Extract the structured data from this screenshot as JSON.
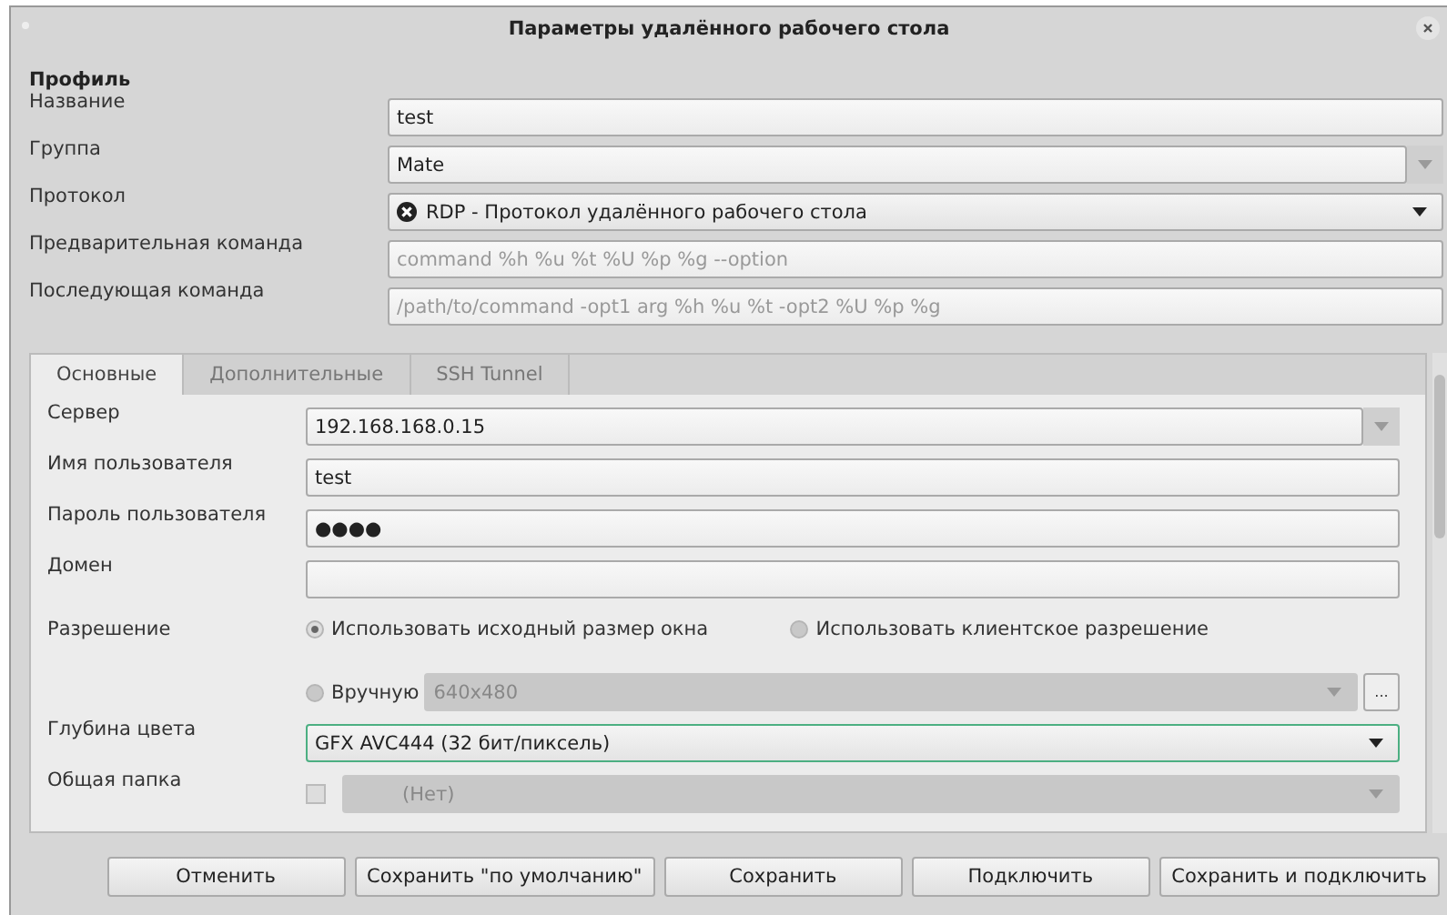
{
  "window": {
    "title": "Параметры удалённого рабочего стола"
  },
  "profile": {
    "heading": "Профиль",
    "fields": [
      {
        "label": "Название",
        "kind": "entry",
        "value": "test"
      },
      {
        "label": "Группа",
        "kind": "combo-entry",
        "value": "Mate"
      },
      {
        "label": "Протокол",
        "kind": "combo",
        "value": "RDP - Протокол удалённого рабочего стола",
        "icon": true
      },
      {
        "label": "Предварительная команда",
        "kind": "entry",
        "placeholder": "command %h %u %t %U %p %g --option"
      },
      {
        "label": "Последующая команда",
        "kind": "entry",
        "placeholder": "/path/to/command -opt1 arg %h %u %t -opt2 %U %p %g"
      }
    ]
  },
  "tabs": [
    {
      "label": "Основные",
      "selected": true
    },
    {
      "label": "Дополнительные",
      "selected": false
    },
    {
      "label": "SSH Tunnel",
      "selected": false
    }
  ],
  "basic": [
    {
      "label": "Сервер",
      "kind": "combo-entry",
      "value": "192.168.168.0.15"
    },
    {
      "label": "Имя пользователя",
      "kind": "entry",
      "value": "test"
    },
    {
      "label": "Пароль пользователя",
      "kind": "entry",
      "value": "●●●●"
    },
    {
      "label": "Домен",
      "kind": "entry"
    },
    {
      "label": "Разрешение",
      "kind": "radios",
      "options": [
        {
          "label": "Использовать исходный размер окна",
          "selected": true
        },
        {
          "label": "Использовать клиентское разрешение",
          "selected": false
        }
      ]
    },
    {
      "kind": "manual",
      "option": {
        "label": "Вручную",
        "selected": false
      },
      "value": "640x480",
      "button": "..."
    },
    {
      "label": "Глубина цвета",
      "kind": "combo",
      "value": "GFX AVC444 (32 бит/пиксель)",
      "focused": true
    },
    {
      "label": "Общая папка",
      "kind": "folder",
      "checked": false,
      "value": "(Нет)"
    }
  ],
  "buttons": [
    "Отменить",
    "Сохранить \"по умолчанию\"",
    "Сохранить",
    "Подключить",
    "Сохранить и подключить"
  ]
}
